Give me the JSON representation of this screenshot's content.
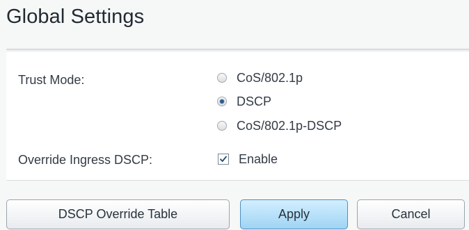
{
  "page": {
    "title": "Global Settings"
  },
  "trust_mode": {
    "label": "Trust Mode:",
    "selected": "DSCP",
    "options": [
      {
        "label": "CoS/802.1p",
        "checked": false
      },
      {
        "label": "DSCP",
        "checked": true
      },
      {
        "label": "CoS/802.1p-DSCP",
        "checked": false
      }
    ]
  },
  "override_ingress": {
    "label": "Override Ingress DSCP:",
    "checkbox_label": "Enable",
    "checked": true
  },
  "buttons": {
    "override_table": "DSCP Override Table",
    "apply": "Apply",
    "cancel": "Cancel"
  },
  "colors": {
    "selected_radio": "#2f5d8c",
    "apply_button": "#9fd4f4",
    "checkmark": "#24476b"
  }
}
